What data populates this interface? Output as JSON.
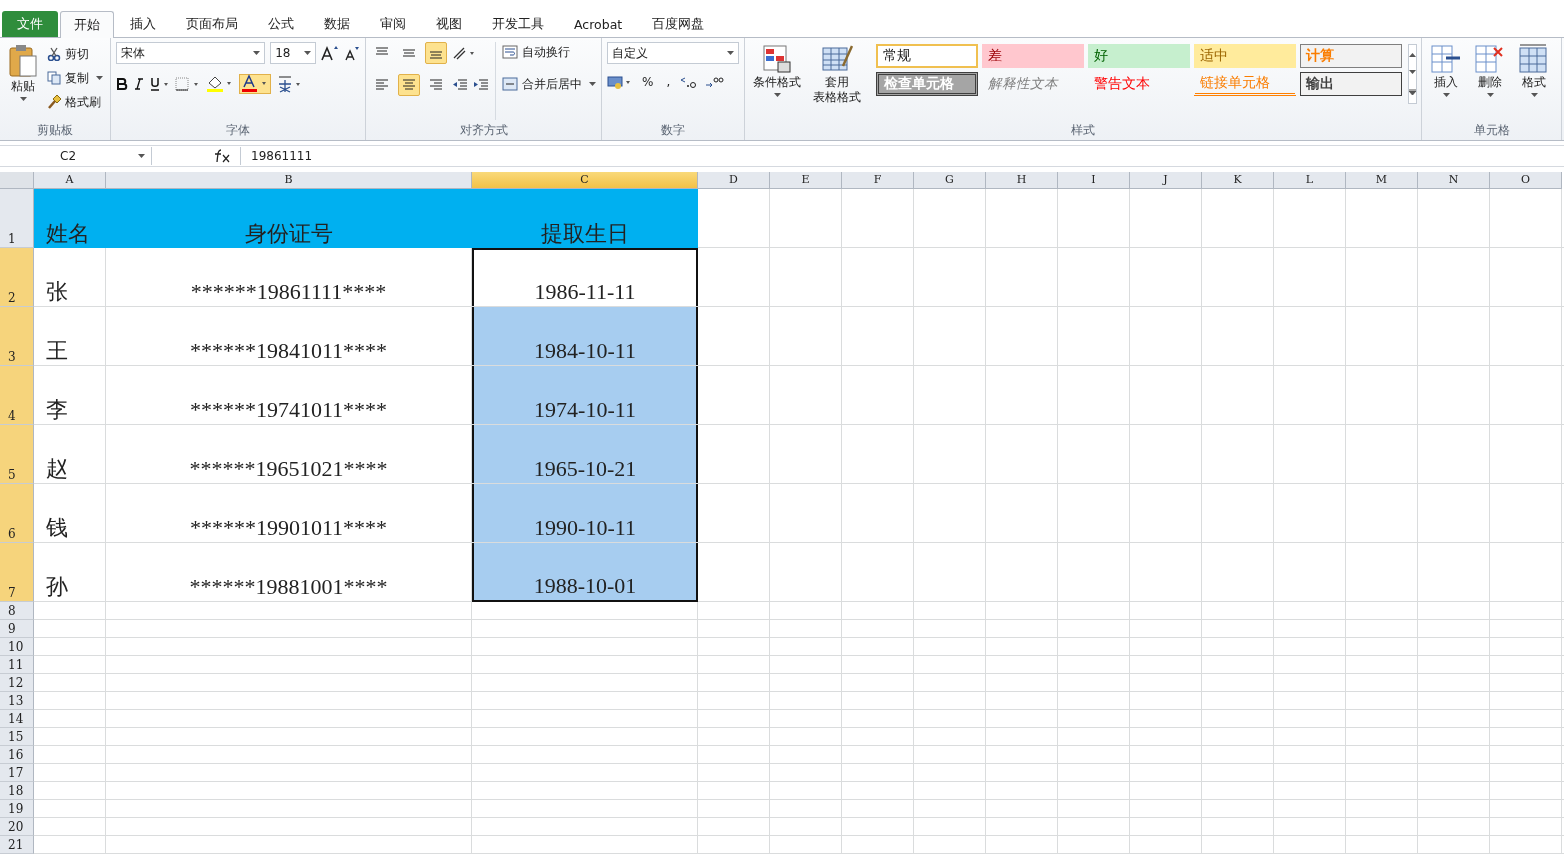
{
  "ribbon_tabs": [
    {
      "label": "文件",
      "kind": "file",
      "selected": false
    },
    {
      "label": "开始",
      "kind": "tab",
      "selected": true
    },
    {
      "label": "插入",
      "kind": "tab",
      "selected": false
    },
    {
      "label": "页面布局",
      "kind": "tab",
      "selected": false
    },
    {
      "label": "公式",
      "kind": "tab",
      "selected": false
    },
    {
      "label": "数据",
      "kind": "tab",
      "selected": false
    },
    {
      "label": "审阅",
      "kind": "tab",
      "selected": false
    },
    {
      "label": "视图",
      "kind": "tab",
      "selected": false
    },
    {
      "label": "开发工具",
      "kind": "tab",
      "selected": false
    },
    {
      "label": "Acrobat",
      "kind": "tab",
      "selected": false
    },
    {
      "label": "百度网盘",
      "kind": "tab",
      "selected": false
    }
  ],
  "clipboard": {
    "label": "剪贴板",
    "paste": "粘贴",
    "cut": "剪切",
    "copy": "复制",
    "format_painter": "格式刷"
  },
  "font": {
    "label": "字体",
    "font_name": "宋体",
    "font_size": "18"
  },
  "alignment": {
    "label": "对齐方式",
    "wrap_text": "自动换行",
    "merge_center": "合并后居中",
    "vertical": [
      {
        "kind": "top",
        "selected": false
      },
      {
        "kind": "middle",
        "selected": false
      },
      {
        "kind": "bottom",
        "selected": true
      }
    ],
    "horizontal": [
      {
        "kind": "left",
        "selected": false
      },
      {
        "kind": "center",
        "selected": true
      },
      {
        "kind": "right",
        "selected": false
      }
    ]
  },
  "number": {
    "label": "数字",
    "format": "自定义",
    "percent": "%",
    "comma": ","
  },
  "styles": {
    "label": "样式",
    "conditional": "条件格式",
    "table_format": [
      "套用",
      "表格格式"
    ],
    "cells": [
      {
        "label": "常规",
        "kind": "normal"
      },
      {
        "label": "差",
        "kind": "bad"
      },
      {
        "label": "好",
        "kind": "good"
      },
      {
        "label": "适中",
        "kind": "neutral"
      },
      {
        "label": "计算",
        "kind": "calculation"
      },
      {
        "label": "检查单元格",
        "kind": "check"
      },
      {
        "label": "解释性文本",
        "kind": "explanatory"
      },
      {
        "label": "警告文本",
        "kind": "warning"
      },
      {
        "label": "链接单元格",
        "kind": "linked"
      },
      {
        "label": "输出",
        "kind": "output"
      }
    ]
  },
  "cells_group": {
    "label": "单元格",
    "insert": "插入",
    "delete": "删除",
    "format": "格式"
  },
  "name_box": "C2",
  "formula": "19861111",
  "columns": [
    {
      "label": "A",
      "selected": false
    },
    {
      "label": "B",
      "selected": false
    },
    {
      "label": "C",
      "selected": true
    },
    {
      "label": "D",
      "selected": false
    },
    {
      "label": "E",
      "selected": false
    },
    {
      "label": "F",
      "selected": false
    },
    {
      "label": "G",
      "selected": false
    },
    {
      "label": "H",
      "selected": false
    },
    {
      "label": "I",
      "selected": false
    },
    {
      "label": "J",
      "selected": false
    },
    {
      "label": "K",
      "selected": false
    },
    {
      "label": "L",
      "selected": false
    },
    {
      "label": "M",
      "selected": false
    },
    {
      "label": "N",
      "selected": false
    },
    {
      "label": "O",
      "selected": false
    }
  ],
  "rows": [
    {
      "number": "1",
      "kind": "header",
      "selected": false,
      "cells": [
        {
          "text": "姓名",
          "selected": false,
          "active": false
        },
        {
          "text": "身份证号",
          "selected": false,
          "active": false
        },
        {
          "text": "提取生日",
          "selected": false,
          "active": false
        }
      ]
    },
    {
      "number": "2",
      "kind": "data",
      "selected": true,
      "cells": [
        {
          "text": "张",
          "selected": false,
          "active": false
        },
        {
          "text": "******19861111****",
          "selected": false,
          "active": false
        },
        {
          "text": "1986-11-11",
          "selected": true,
          "active": true
        }
      ]
    },
    {
      "number": "3",
      "kind": "data",
      "selected": true,
      "cells": [
        {
          "text": "王",
          "selected": false,
          "active": false
        },
        {
          "text": "******19841011****",
          "selected": false,
          "active": false
        },
        {
          "text": "1984-10-11",
          "selected": true,
          "active": false
        }
      ]
    },
    {
      "number": "4",
      "kind": "data",
      "selected": true,
      "cells": [
        {
          "text": "李",
          "selected": false,
          "active": false
        },
        {
          "text": "******19741011****",
          "selected": false,
          "active": false
        },
        {
          "text": "1974-10-11",
          "selected": true,
          "active": false
        }
      ]
    },
    {
      "number": "5",
      "kind": "data",
      "selected": true,
      "cells": [
        {
          "text": "赵",
          "selected": false,
          "active": false
        },
        {
          "text": "******19651021****",
          "selected": false,
          "active": false
        },
        {
          "text": "1965-10-21",
          "selected": true,
          "active": false
        }
      ]
    },
    {
      "number": "6",
      "kind": "data",
      "selected": true,
      "cells": [
        {
          "text": "钱",
          "selected": false,
          "active": false
        },
        {
          "text": "******19901011****",
          "selected": false,
          "active": false
        },
        {
          "text": "1990-10-11",
          "selected": true,
          "active": false
        }
      ]
    },
    {
      "number": "7",
      "kind": "data",
      "selected": true,
      "cells": [
        {
          "text": "孙",
          "selected": false,
          "active": false
        },
        {
          "text": "******19881001****",
          "selected": false,
          "active": false
        },
        {
          "text": "1988-10-01",
          "selected": true,
          "active": false
        }
      ]
    },
    {
      "number": "8",
      "kind": "empty",
      "selected": false,
      "cells": []
    },
    {
      "number": "9",
      "kind": "empty",
      "selected": false,
      "cells": []
    },
    {
      "number": "10",
      "kind": "empty",
      "selected": false,
      "cells": []
    },
    {
      "number": "11",
      "kind": "empty",
      "selected": false,
      "cells": []
    },
    {
      "number": "12",
      "kind": "empty",
      "selected": false,
      "cells": []
    },
    {
      "number": "13",
      "kind": "empty",
      "selected": false,
      "cells": []
    },
    {
      "number": "14",
      "kind": "empty",
      "selected": false,
      "cells": []
    },
    {
      "number": "15",
      "kind": "empty",
      "selected": false,
      "cells": []
    },
    {
      "number": "16",
      "kind": "empty",
      "selected": false,
      "cells": []
    },
    {
      "number": "17",
      "kind": "empty",
      "selected": false,
      "cells": []
    },
    {
      "number": "18",
      "kind": "empty",
      "selected": false,
      "cells": []
    },
    {
      "number": "19",
      "kind": "empty",
      "selected": false,
      "cells": []
    },
    {
      "number": "20",
      "kind": "empty",
      "selected": false,
      "cells": []
    },
    {
      "number": "21",
      "kind": "empty",
      "selected": false,
      "cells": []
    }
  ]
}
